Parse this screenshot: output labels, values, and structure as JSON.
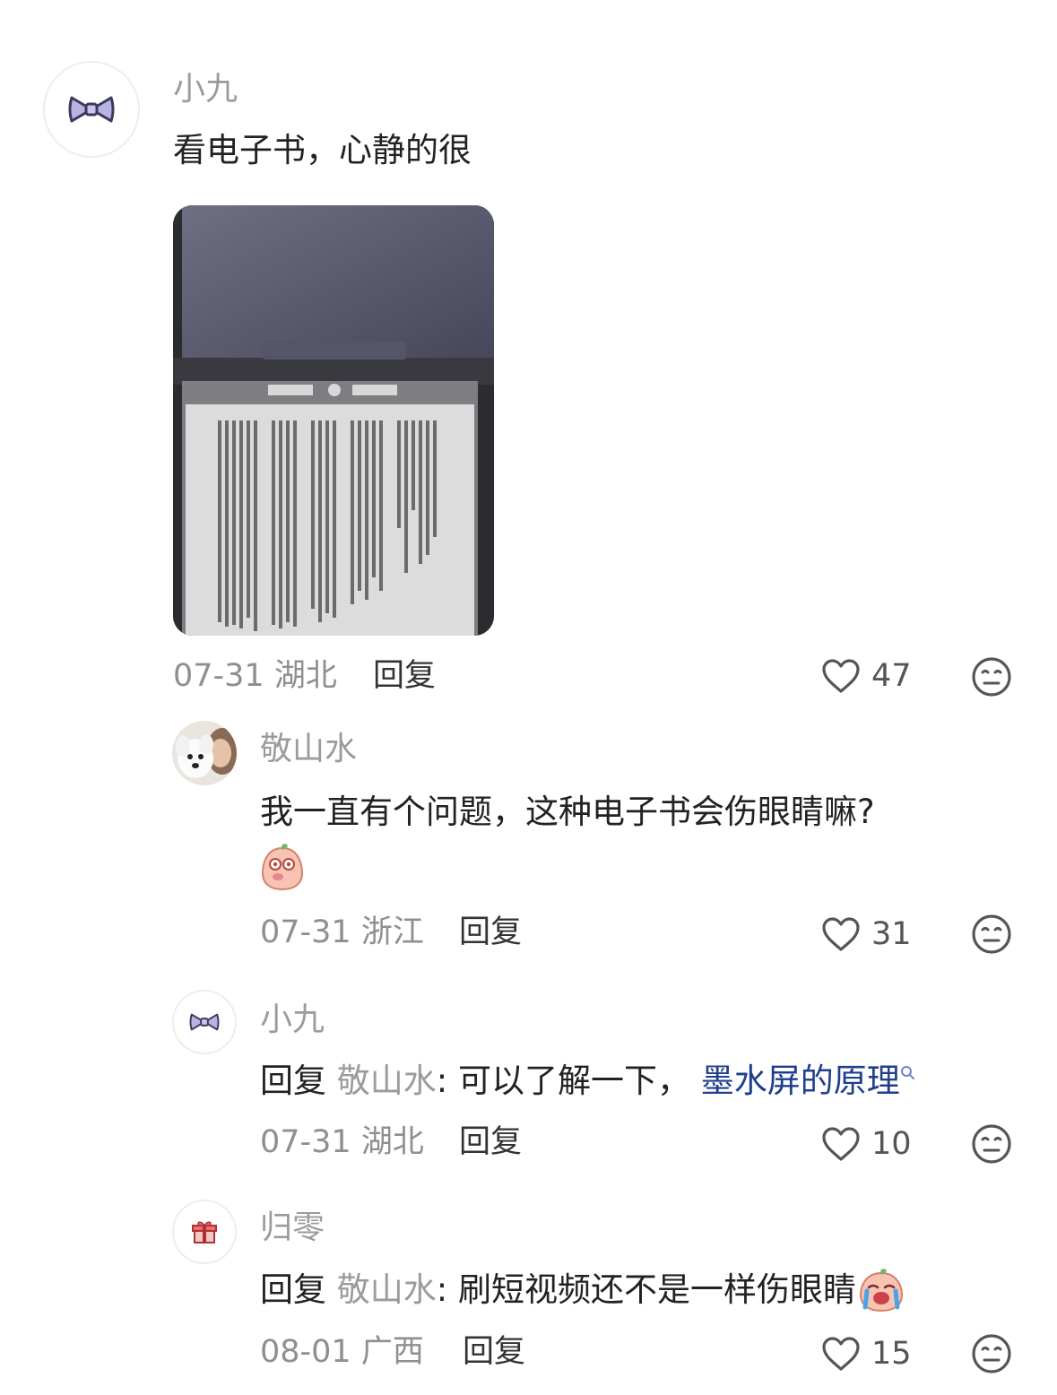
{
  "colors": {
    "username": "#9b9b9b",
    "text": "#222222",
    "meta": "#8f8f8f",
    "link": "#1f3f8c"
  },
  "comment": {
    "username": "小九",
    "avatar_icon": "bow-icon",
    "text": "看电子书，心静的很",
    "photo_icon": "ereader-photo",
    "date": "07-31",
    "location": "湖北",
    "reply_label": "回复",
    "likes": "47"
  },
  "replies": [
    {
      "username": "敬山水",
      "avatar_icon": "dog-photo-avatar",
      "text": "我一直有个问题，这种电子书会伤眼睛嘛?",
      "sticker_icon": "peach-confused-sticker",
      "date": "07-31",
      "location": "浙江",
      "reply_label": "回复",
      "likes": "31"
    },
    {
      "username": "小九",
      "avatar_icon": "bow-icon",
      "reply_prefix": "回复",
      "reply_to": "敬山水",
      "text": ": 可以了解一下，",
      "link_text": "墨水屏的原理",
      "date": "07-31",
      "location": "湖北",
      "reply_label": "回复",
      "likes": "10"
    },
    {
      "username": "归零",
      "avatar_icon": "gift-icon",
      "reply_prefix": "回复",
      "reply_to": "敬山水",
      "text": ": 刷短视频还不是一样伤眼睛",
      "sticker_icon": "peach-crying-sticker",
      "date": "08-01",
      "location": "广西",
      "reply_label": "回复",
      "likes": "15"
    }
  ]
}
